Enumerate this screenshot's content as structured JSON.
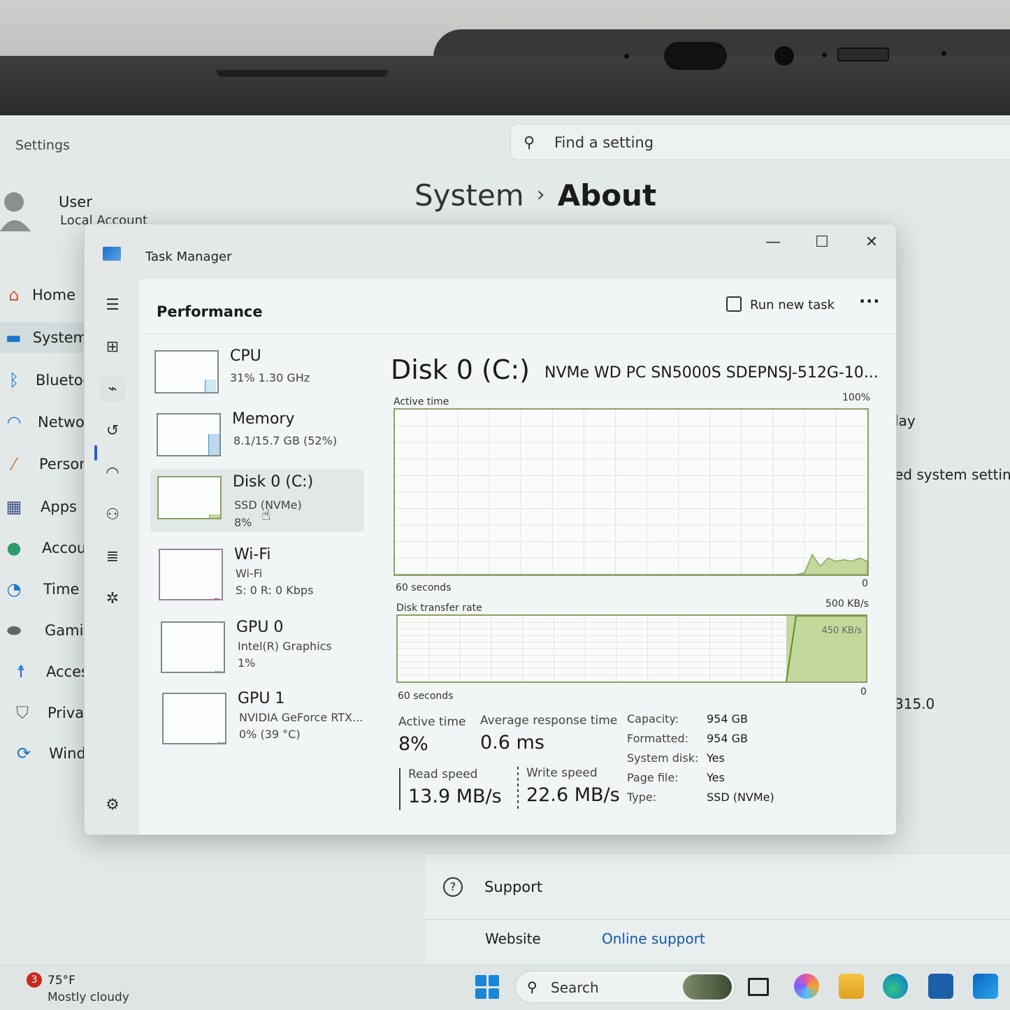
{
  "settings": {
    "app_title": "Settings",
    "search_placeholder": "Find a setting",
    "user_name": "User",
    "user_account": "Local Account",
    "breadcrumb": [
      "System",
      "About"
    ],
    "nav": [
      {
        "label": "Home",
        "icon": "home-icon"
      },
      {
        "label": "System",
        "icon": "monitor-icon"
      },
      {
        "label": "Bluetoo",
        "icon": "bluetooth-icon"
      },
      {
        "label": "Networ",
        "icon": "wifi-icon"
      },
      {
        "label": "Persona",
        "icon": "brush-icon"
      },
      {
        "label": "Apps",
        "icon": "apps-icon"
      },
      {
        "label": "Account",
        "icon": "person-icon"
      },
      {
        "label": "Time &",
        "icon": "clock-globe-icon"
      },
      {
        "label": "Gaming",
        "icon": "controller-icon"
      },
      {
        "label": "Accessit",
        "icon": "accessibility-icon"
      },
      {
        "label": "Privacy",
        "icon": "shield-icon"
      },
      {
        "label": "Window",
        "icon": "update-icon"
      }
    ],
    "right_fragments": [
      "lay",
      "ed system settings",
      "315.0"
    ],
    "support_label": "Support",
    "website_label": "Website",
    "online_support": "Online support"
  },
  "taskbar": {
    "weather_badge": "3",
    "weather_temp": "75°F",
    "weather_desc": "Mostly cloudy",
    "search_label": "Search"
  },
  "task_manager": {
    "title": "Task Manager",
    "window_controls": {
      "minimize": "—",
      "maximize": "☐",
      "close": "✕"
    },
    "page_title": "Performance",
    "run_new_task": "Run new task",
    "more": "···",
    "resources": [
      {
        "name": "CPU",
        "lines": [
          "31% 1.30 GHz"
        ],
        "fill": 0.31,
        "selected": false
      },
      {
        "name": "Memory",
        "lines": [
          "8.1/15.7 GB (52%)"
        ],
        "fill": 0.52,
        "selected": false
      },
      {
        "name": "Disk 0 (C:)",
        "lines": [
          "SSD (NVMe)",
          "8%"
        ],
        "fill": 0.08,
        "selected": true
      },
      {
        "name": "Wi-Fi",
        "lines": [
          "Wi-Fi",
          "S: 0 R: 0 Kbps"
        ],
        "fill": 0.0,
        "selected": false
      },
      {
        "name": "GPU 0",
        "lines": [
          "Intel(R) Graphics",
          "1%"
        ],
        "fill": 0.01,
        "selected": false
      },
      {
        "name": "GPU 1",
        "lines": [
          "NVIDIA GeForce RTX...",
          "0% (39 °C)"
        ],
        "fill": 0.0,
        "selected": false
      }
    ],
    "detail": {
      "title": "Disk 0 (C:)",
      "model": "NVMe WD PC SN5000S SDEPNSJ-512G-10...",
      "active_time_label": "Active time",
      "active_time_max": "100%",
      "time_span": "60 seconds",
      "zero": "0",
      "transfer_label": "Disk transfer rate",
      "transfer_max": "500 KB/s",
      "transfer_marker": "450 KB/s",
      "stats": {
        "active_time_label": "Active time",
        "active_time_value": "8%",
        "response_label": "Average response time",
        "response_value": "0.6 ms",
        "read_label": "Read speed",
        "read_value": "13.9 MB/s",
        "write_label": "Write speed",
        "write_value": "22.6 MB/s"
      },
      "properties": [
        {
          "label": "Capacity:",
          "value": "954 GB"
        },
        {
          "label": "Formatted:",
          "value": "954 GB"
        },
        {
          "label": "System disk:",
          "value": "Yes"
        },
        {
          "label": "Page file:",
          "value": "Yes"
        },
        {
          "label": "Type:",
          "value": "SSD (NVMe)"
        }
      ]
    },
    "active_time_series": [
      0,
      0,
      0,
      0,
      0,
      0,
      0,
      0,
      0,
      0,
      0,
      0,
      0,
      0,
      0,
      0,
      0,
      0,
      0,
      0,
      0,
      0,
      0,
      0,
      0,
      0,
      0,
      0,
      0,
      0,
      0,
      0,
      0,
      0,
      0,
      0,
      0,
      0,
      0,
      0,
      0,
      0,
      0,
      0,
      0,
      0,
      0,
      0,
      0,
      0,
      0,
      0,
      1,
      12,
      5,
      10,
      8,
      9,
      8,
      10,
      8
    ],
    "colors": {
      "disk": "#8da064",
      "disk_fill": "#c5d89c",
      "accent": "#1a64c4"
    }
  }
}
